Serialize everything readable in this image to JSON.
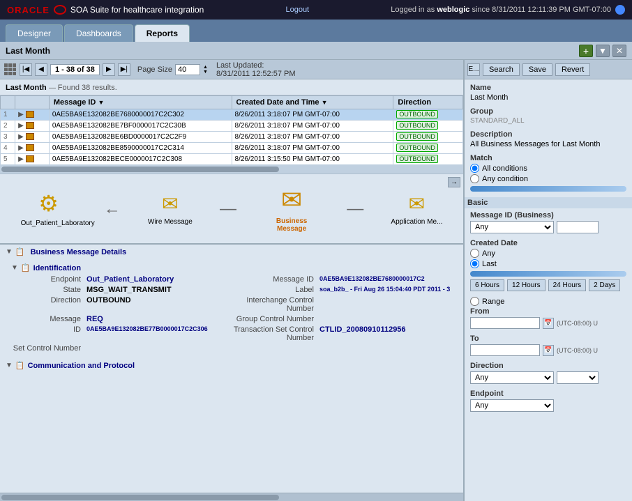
{
  "topbar": {
    "oracle_text": "ORACLE",
    "app_title": "SOA Suite for healthcare integration",
    "logout_label": "Logout",
    "login_info": "Logged in as",
    "username": "weblogic",
    "login_since": "since 8/31/2011 12:11:39 PM GMT-07:00"
  },
  "tabs": [
    {
      "label": "Designer",
      "active": false
    },
    {
      "label": "Dashboards",
      "active": false
    },
    {
      "label": "Reports",
      "active": true
    }
  ],
  "subtoolbar": {
    "title": "Last Month"
  },
  "table_toolbar": {
    "page_range": "1 - 38 of 38",
    "page_size_label": "Page Size",
    "page_size_value": "40",
    "last_updated_label": "Last Updated:",
    "last_updated_value": "8/31/2011 12:52:57 PM"
  },
  "month_header": {
    "title": "Last Month",
    "found": "Found 38 results."
  },
  "table": {
    "columns": [
      "Message ID",
      "Created Date and Time",
      "Direction"
    ],
    "rows": [
      {
        "num": 1,
        "id": "0AE5BA9E132082BE7680000017C2C302",
        "date": "8/26/2011 3:18:07 PM GMT-07:00",
        "direction": "OUTBOUND",
        "selected": true
      },
      {
        "num": 2,
        "id": "0AE5BA9E132082BE7BF0000017C2C30B",
        "date": "8/26/2011 3:18:07 PM GMT-07:00",
        "direction": "OUTBOUND",
        "selected": false
      },
      {
        "num": 3,
        "id": "0AE5BA9E132082BE6BD0000017C2C2F9",
        "date": "8/26/2011 3:18:07 PM GMT-07:00",
        "direction": "OUTBOUND",
        "selected": false
      },
      {
        "num": 4,
        "id": "0AE5BA9E132082BE8590000017C2C314",
        "date": "8/26/2011 3:18:07 PM GMT-07:00",
        "direction": "OUTBOUND",
        "selected": false
      },
      {
        "num": 5,
        "id": "0AE5BA9E132082BECE0000017C2C308",
        "date": "8/26/2011 3:15:50 PM GMT-07:00",
        "direction": "OUTBOUND",
        "selected": false
      }
    ]
  },
  "flow": {
    "nodes": [
      {
        "label": "Out_Patient_Laboratory",
        "icon": "gear",
        "selected": false
      },
      {
        "label": "Wire Message",
        "icon": "envelope",
        "selected": false
      },
      {
        "label": "Business Message",
        "icon": "envelope-large",
        "selected": true
      },
      {
        "label": "Application Me...",
        "icon": "envelope",
        "selected": false
      }
    ]
  },
  "detail": {
    "title": "Business Message Details",
    "identification_title": "Identification",
    "fields": {
      "endpoint_label": "Endpoint",
      "endpoint_value": "Out_Patient_Laboratory",
      "state_label": "State",
      "state_value": "MSG_WAIT_TRANSMIT",
      "direction_label": "Direction",
      "direction_value": "OUTBOUND",
      "message_label": "Message",
      "message_type": "REQ",
      "id_label": "ID",
      "id_value": "0AE5BA9E132082BE77B0000017C2C306",
      "msgid_label": "Message ID",
      "msgid_value": "0AE5BA9E132082BE7680000017C2",
      "label_label": "Label",
      "label_value": "soa_b2b_ - Fri Aug 26 15:04:40 PDT 2011 - 3",
      "icn_label": "Interchange Control Number",
      "gcn_label": "Group Control Number",
      "tcn_label": "Transaction Set Control Number",
      "tcn_value": "CTLID_20080910112956",
      "set_label": "Set Control Number"
    },
    "comm_title": "Communication and Protocol"
  },
  "filter": {
    "expand_label": "E...",
    "search_label": "Search",
    "save_label": "Save",
    "revert_label": "Revert",
    "name_label": "Name",
    "name_value": "Last Month",
    "group_label": "Group",
    "standard_label": "STANDARD_ALL",
    "description_label": "Description",
    "description_value": "All Business Messages for Last Month",
    "match_label": "Match",
    "all_conditions_label": "All conditions",
    "any_condition_label": "Any condition",
    "basic_section": "Basic",
    "message_id_label": "Message ID (Business)",
    "any_label1": "Any",
    "created_date_label": "Created Date",
    "any_radio": "Any",
    "last_radio": "Last",
    "slider_label": "",
    "time_buttons": [
      "6 Hours",
      "12 Hours",
      "24 Hours",
      "2 Days"
    ],
    "range_label": "Range",
    "from_label": "From",
    "to_label": "To",
    "tz_label1": "(UTC-08:00) U",
    "tz_label2": "(UTC-08:00) U",
    "direction_label": "Direction",
    "any_direction": "Any",
    "endpoint_label": "Endpoint",
    "any_endpoint": "Any"
  }
}
